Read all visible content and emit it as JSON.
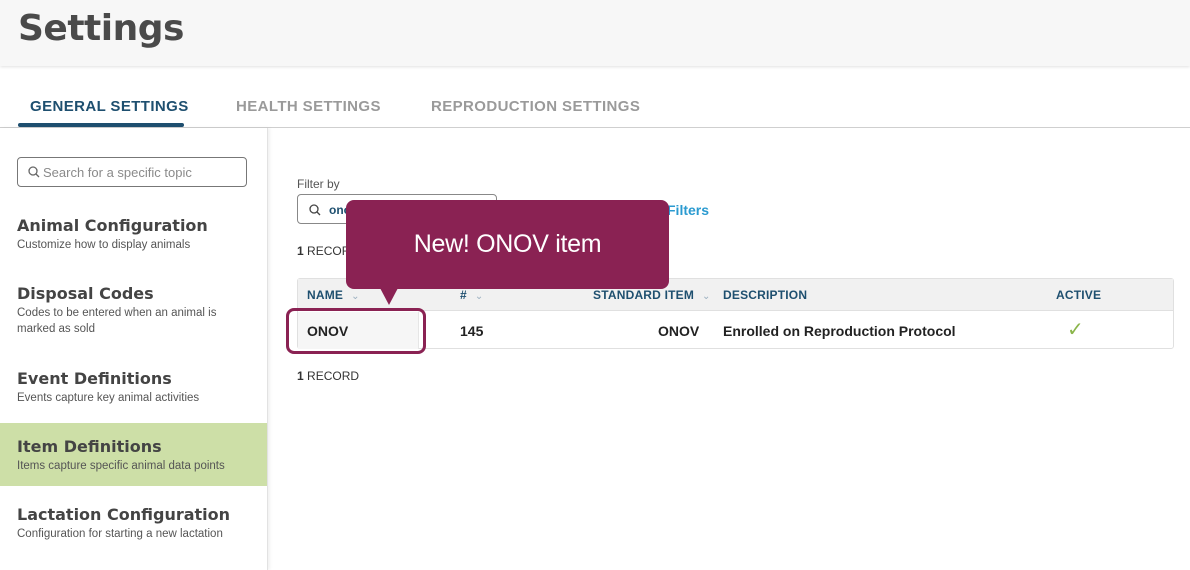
{
  "header": {
    "title": "Settings"
  },
  "tabs": [
    {
      "label": "GENERAL SETTINGS",
      "active": true
    },
    {
      "label": "HEALTH SETTINGS",
      "active": false
    },
    {
      "label": "REPRODUCTION SETTINGS",
      "active": false
    }
  ],
  "sidebar": {
    "search_placeholder": "Search for a specific topic",
    "items": [
      {
        "title": "Animal Configuration",
        "desc": "Customize how to display animals"
      },
      {
        "title": "Disposal Codes",
        "desc": "Codes to be entered when an animal is marked as sold"
      },
      {
        "title": "Event Definitions",
        "desc": "Events capture key animal activities"
      },
      {
        "title": "Item Definitions",
        "desc": "Items capture specific animal data points",
        "active": true
      },
      {
        "title": "Lactation Configuration",
        "desc": "Configuration for starting a new lactation"
      }
    ]
  },
  "main": {
    "filter_label": "Filter by",
    "filter_value": "ono",
    "filters_link": "Filters",
    "record_count_top": {
      "count": "1",
      "label": "RECORD"
    },
    "record_count_bottom": {
      "count": "1",
      "label": "RECORD"
    },
    "table": {
      "headers": [
        "NAME",
        "#",
        "STANDARD ITEM",
        "DESCRIPTION",
        "ACTIVE"
      ],
      "rows": [
        {
          "name": "ONOV",
          "number": "145",
          "standard_item": "ONOV",
          "description": "Enrolled on Reproduction Protocol",
          "active": true
        }
      ]
    }
  },
  "callout": {
    "text": "New! ONOV item"
  },
  "colors": {
    "brand_navy": "#1e4f6f",
    "callout": "#8a2253",
    "active_nav": "#cddfa7",
    "link": "#2a9ad0",
    "check": "#8ab54a"
  }
}
